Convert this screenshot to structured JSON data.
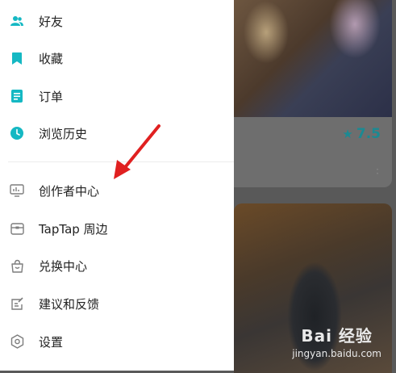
{
  "colors": {
    "accent": "#15b8c3",
    "arrow": "#e02020",
    "icon_gray": "#7d7d7d"
  },
  "drawer": {
    "items": [
      {
        "label": "好友",
        "icon": "friends-icon"
      },
      {
        "label": "收藏",
        "icon": "bookmark-icon"
      },
      {
        "label": "订单",
        "icon": "order-icon"
      },
      {
        "label": "浏览历史",
        "icon": "history-clock-icon"
      },
      {
        "label": "创作者中心",
        "icon": "monitor-icon"
      },
      {
        "label": "TapTap 周边",
        "icon": "merch-icon"
      },
      {
        "label": "兑换中心",
        "icon": "exchange-bag-icon"
      },
      {
        "label": "建议和反馈",
        "icon": "feedback-icon"
      },
      {
        "label": "设置",
        "icon": "settings-icon"
      }
    ]
  },
  "background": {
    "rating": "7.5",
    "watermark_line1": "Bai 经验",
    "watermark_line2": "jingyan.baidu.com"
  }
}
